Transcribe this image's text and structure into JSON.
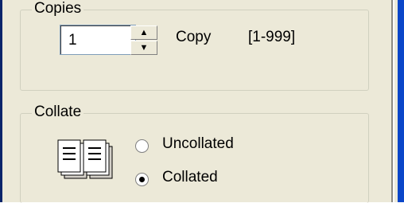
{
  "copies": {
    "group_title": "Copies",
    "value": "1",
    "unit_label": "Copy",
    "range_label": "[1-999]"
  },
  "collate": {
    "group_title": "Collate",
    "options": [
      {
        "label": "Uncollated",
        "selected": false
      },
      {
        "label": "Collated",
        "selected": true
      }
    ]
  },
  "colors": {
    "panel": "#ece9d8",
    "window_frame": "#0a46c9"
  },
  "icons": {
    "spin_up": "up-arrow-icon",
    "spin_down": "down-arrow-icon",
    "collate": "collated-pages-icon"
  }
}
